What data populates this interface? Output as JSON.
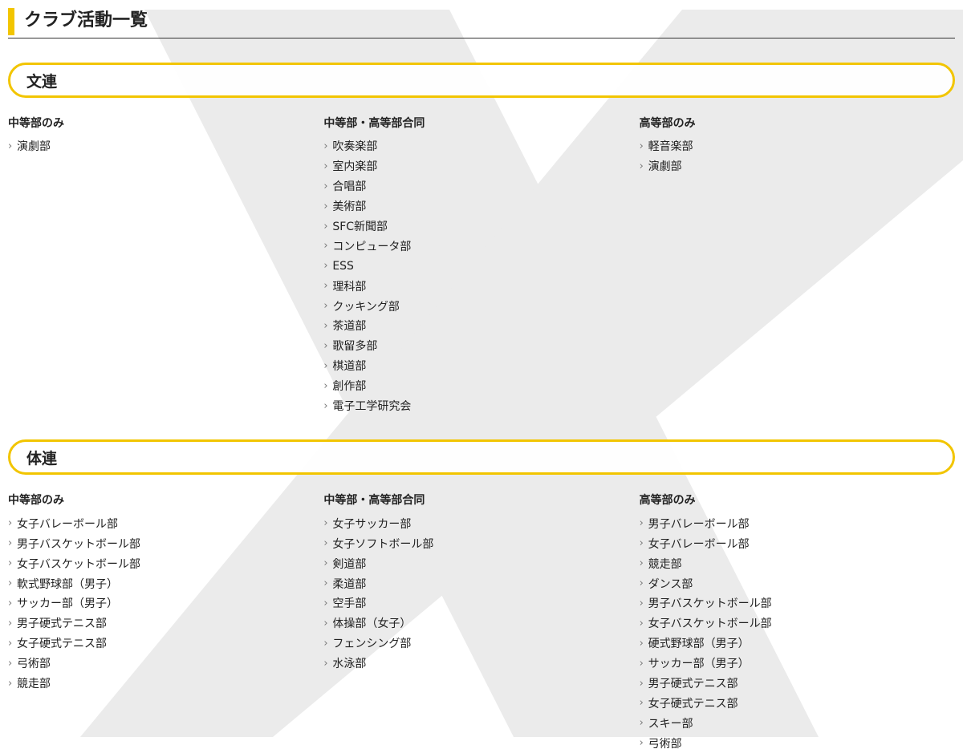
{
  "page_title": "クラブ活動一覧",
  "icons": {
    "list_chevron": "chevron-right-icon",
    "chevron_glyph": "›"
  },
  "colors": {
    "accent": "#f2c500",
    "text": "#222222",
    "background_graphic": "#ebebeb",
    "divider": "#333333"
  },
  "sections": [
    {
      "title": "文連",
      "columns": [
        {
          "title": "中等部のみ",
          "items": [
            "演劇部"
          ]
        },
        {
          "title": "中等部・高等部合同",
          "items": [
            "吹奏楽部",
            "室内楽部",
            "合唱部",
            "美術部",
            "SFC新聞部",
            "コンピュータ部",
            "ESS",
            "理科部",
            "クッキング部",
            "茶道部",
            "歌留多部",
            "棋道部",
            "創作部",
            "電子工学研究会"
          ]
        },
        {
          "title": "高等部のみ",
          "items": [
            "軽音楽部",
            "演劇部"
          ]
        }
      ]
    },
    {
      "title": "体連",
      "columns": [
        {
          "title": "中等部のみ",
          "items": [
            "女子バレーボール部",
            "男子バスケットボール部",
            "女子バスケットボール部",
            "軟式野球部（男子）",
            "サッカー部（男子）",
            "男子硬式テニス部",
            "女子硬式テニス部",
            "弓術部",
            "競走部"
          ]
        },
        {
          "title": "中等部・高等部合同",
          "items": [
            "女子サッカー部",
            "女子ソフトボール部",
            "剣道部",
            "柔道部",
            "空手部",
            "体操部（女子）",
            "フェンシング部",
            "水泳部"
          ]
        },
        {
          "title": "高等部のみ",
          "items": [
            "男子バレーボール部",
            "女子バレーボール部",
            "競走部",
            "ダンス部",
            "男子バスケットボール部",
            "女子バスケットボール部",
            "硬式野球部（男子）",
            "サッカー部（男子）",
            "男子硬式テニス部",
            "女子硬式テニス部",
            "スキー部",
            "弓術部"
          ]
        }
      ]
    }
  ]
}
